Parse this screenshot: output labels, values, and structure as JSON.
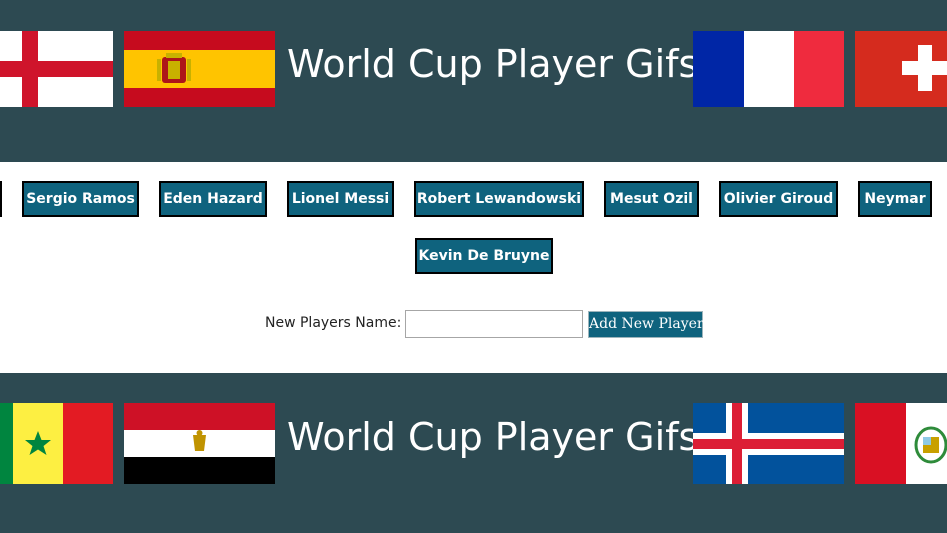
{
  "header": {
    "title": "World Cup Player Gifs",
    "flags": [
      "england-flag",
      "spain-flag",
      "france-flag",
      "switzerland-flag"
    ]
  },
  "players": [
    "Sergio Ramos",
    "Eden Hazard",
    "Lionel Messi",
    "Robert Lewandowski",
    "Mesut Ozil",
    "Olivier Giroud",
    "Neymar",
    "Kevin De Bruyne"
  ],
  "form": {
    "label": "New Players Name:",
    "input_value": "",
    "button_label": "Add New Player"
  },
  "footer": {
    "title": "World Cup Player Gifs",
    "flags": [
      "senegal-flag",
      "egypt-flag",
      "iceland-flag",
      "peru-flag"
    ]
  },
  "colors": {
    "banner_bg": "#2d4a52",
    "button_bg": "#0f637e",
    "button_text": "#ffffff"
  }
}
